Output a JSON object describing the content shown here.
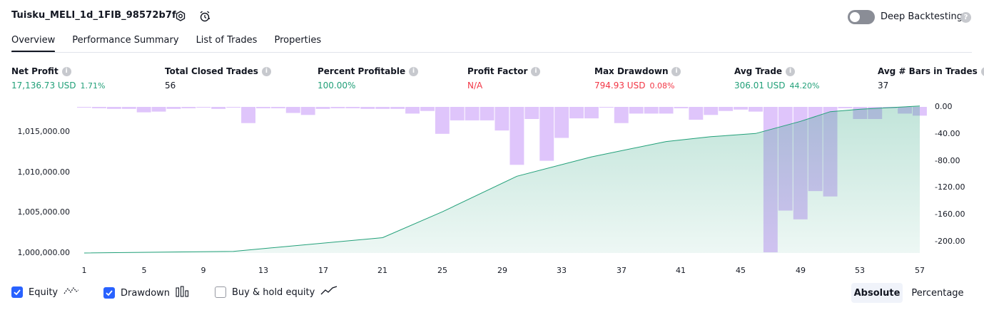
{
  "header": {
    "title": "Tuisku_MELI_1d_1FIB_98572b7f",
    "deep_backtesting_label": "Deep Backtesting",
    "deep_backtesting_on": false
  },
  "tabs": [
    {
      "label": "Overview",
      "active": true
    },
    {
      "label": "Performance Summary",
      "active": false
    },
    {
      "label": "List of Trades",
      "active": false
    },
    {
      "label": "Properties",
      "active": false
    }
  ],
  "metrics": [
    {
      "label": "Net Profit",
      "value": "17,136.73 USD",
      "pct": "1.71%",
      "color": "green"
    },
    {
      "label": "Total Closed Trades",
      "value": "56",
      "pct": "",
      "color": "dark"
    },
    {
      "label": "Percent Profitable",
      "value": "100.00%",
      "pct": "",
      "color": "green"
    },
    {
      "label": "Profit Factor",
      "value": "N/A",
      "pct": "",
      "color": "red"
    },
    {
      "label": "Max Drawdown",
      "value": "794.93 USD",
      "pct": "0.08%",
      "color": "red"
    },
    {
      "label": "Avg Trade",
      "value": "306.01 USD",
      "pct": "44.20%",
      "color": "green"
    },
    {
      "label": "Avg # Bars in Trades",
      "value": "37",
      "pct": "",
      "color": "dark"
    }
  ],
  "chart_data": {
    "type": "area",
    "equity": {
      "x": [
        1,
        11,
        21,
        25,
        30,
        35,
        40,
        43,
        46,
        49,
        51,
        53,
        55,
        57
      ],
      "y": [
        1000000,
        1000200,
        1001900,
        1005100,
        1009500,
        1011900,
        1013800,
        1014400,
        1014800,
        1016300,
        1017500,
        1017800,
        1018000,
        1018200
      ],
      "ylim": [
        999000,
        1018000
      ],
      "yticks": [
        "1,000,000.00",
        "1,005,000.00",
        "1,010,000.00",
        "1,015,000.00"
      ],
      "color": "#22a079"
    },
    "drawdown": {
      "x": [
        1,
        2,
        3,
        4,
        5,
        6,
        7,
        8,
        9,
        10,
        11,
        12,
        13,
        14,
        15,
        16,
        17,
        18,
        19,
        20,
        21,
        22,
        23,
        24,
        25,
        26,
        27,
        28,
        29,
        30,
        31,
        32,
        33,
        34,
        35,
        36,
        37,
        38,
        39,
        40,
        41,
        42,
        43,
        44,
        45,
        46,
        47,
        48,
        49,
        50,
        51,
        52,
        53,
        54,
        55,
        56,
        57
      ],
      "values": [
        -1,
        -2,
        -3,
        -3,
        -8,
        -7,
        -3,
        -2,
        -1,
        -3,
        -1,
        -24,
        -2,
        -2,
        -9,
        -12,
        -3,
        -2,
        -2,
        -3,
        -3,
        -3,
        -10,
        -6,
        -40,
        -20,
        -20,
        -20,
        -35,
        -86,
        -18,
        -80,
        -46,
        -17,
        -17,
        -1,
        -24,
        -10,
        -10,
        -10,
        -2,
        -19,
        -12,
        -6,
        -4,
        -7,
        -216,
        -154,
        -167,
        -125,
        -133,
        -2,
        -18,
        -18,
        -2,
        -10,
        -13
      ],
      "ylim": [
        -215,
        0
      ],
      "yticks": [
        "0.00",
        "-40.00",
        "-80.00",
        "-120.00",
        "-160.00",
        "-200.00"
      ],
      "color": "#c496f7"
    },
    "xticks": [
      "1",
      "5",
      "9",
      "13",
      "17",
      "21",
      "25",
      "29",
      "33",
      "37",
      "41",
      "45",
      "49",
      "53",
      "57"
    ]
  },
  "legend": {
    "equity": {
      "label": "Equity",
      "checked": true
    },
    "drawdown": {
      "label": "Drawdown",
      "checked": true
    },
    "buyhold": {
      "label": "Buy & hold equity",
      "checked": false
    }
  },
  "mode": {
    "absolute": "Absolute",
    "percentage": "Percentage",
    "selected": "Absolute"
  }
}
